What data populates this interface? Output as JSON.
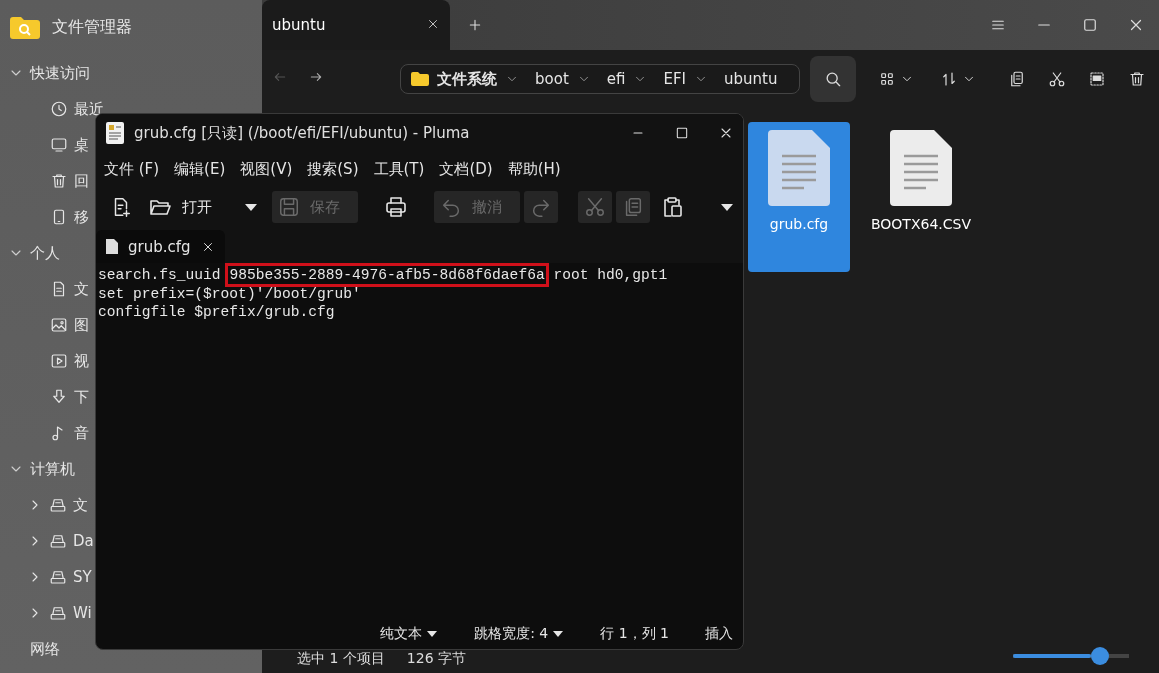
{
  "app": {
    "title": "文件管理器"
  },
  "sidebar": {
    "sections": [
      {
        "label": "快速访问",
        "expanded": true,
        "items": [
          {
            "label": "最近"
          },
          {
            "label": "桌"
          },
          {
            "label": "回"
          },
          {
            "label": "移"
          }
        ]
      },
      {
        "label": "个人",
        "expanded": true,
        "items": [
          {
            "label": "文"
          },
          {
            "label": "图"
          },
          {
            "label": "视"
          },
          {
            "label": "下"
          },
          {
            "label": "音"
          }
        ]
      },
      {
        "label": "计算机",
        "expanded": true,
        "items": [
          {
            "label": "文",
            "expanded": false
          },
          {
            "label": "Da",
            "expanded": false
          },
          {
            "label": "SY",
            "expanded": false
          },
          {
            "label": "Wi",
            "expanded": false
          }
        ]
      },
      {
        "label": "网络"
      }
    ]
  },
  "tabs": [
    {
      "label": "ubuntu",
      "selected": true
    }
  ],
  "breadcrumb": [
    "文件系统",
    "boot",
    "efi",
    "EFI",
    "ubuntu"
  ],
  "files": [
    {
      "name": "grub.cfg",
      "selected": true
    },
    {
      "name": "BOOTX64.CSV",
      "selected": false
    }
  ],
  "status_bar": {
    "selection": "选中 1 个项目",
    "size": "126 字节",
    "zoom": {
      "level": 0.67
    }
  },
  "editor": {
    "title": "grub.cfg [只读] (/boot/efi/EFI/ubuntu) - Pluma",
    "menu": [
      "文件 (F)",
      "编辑(E)",
      "视图(V)",
      "搜索(S)",
      "工具(T)",
      "文档(D)",
      "帮助(H)"
    ],
    "toolbar": [
      {
        "kind": "new",
        "disabled": false
      },
      {
        "kind": "open",
        "label": "打开",
        "disabled": false
      },
      {
        "kind": "dropdown",
        "disabled": false
      },
      {
        "kind": "save",
        "label": "保存",
        "disabled": true
      },
      {
        "kind": "sep"
      },
      {
        "kind": "print",
        "disabled": false
      },
      {
        "kind": "sep"
      },
      {
        "kind": "undo",
        "label": "撤消",
        "disabled": true
      },
      {
        "kind": "redo",
        "disabled": true
      },
      {
        "kind": "sep"
      },
      {
        "kind": "cut",
        "disabled": true
      },
      {
        "kind": "copy",
        "disabled": true
      },
      {
        "kind": "paste",
        "disabled": false
      },
      {
        "kind": "sep"
      },
      {
        "kind": "more",
        "disabled": false
      }
    ],
    "tabs": [
      {
        "label": "grub.cfg",
        "selected": true
      }
    ],
    "lines": [
      {
        "prefix": "search.fs_uuid ",
        "highlight": "985be355-2889-4976-afb5-8d68f6daef6a",
        "suffix": " root hd0,gpt1"
      },
      {
        "prefix": "set prefix=($root)'/boot/grub'"
      },
      {
        "prefix": "configfile $prefix/grub.cfg"
      }
    ],
    "status": {
      "language": "纯文本",
      "tab_width": "跳格宽度: 4",
      "position": "行 1，列 1",
      "mode": "插入"
    }
  }
}
